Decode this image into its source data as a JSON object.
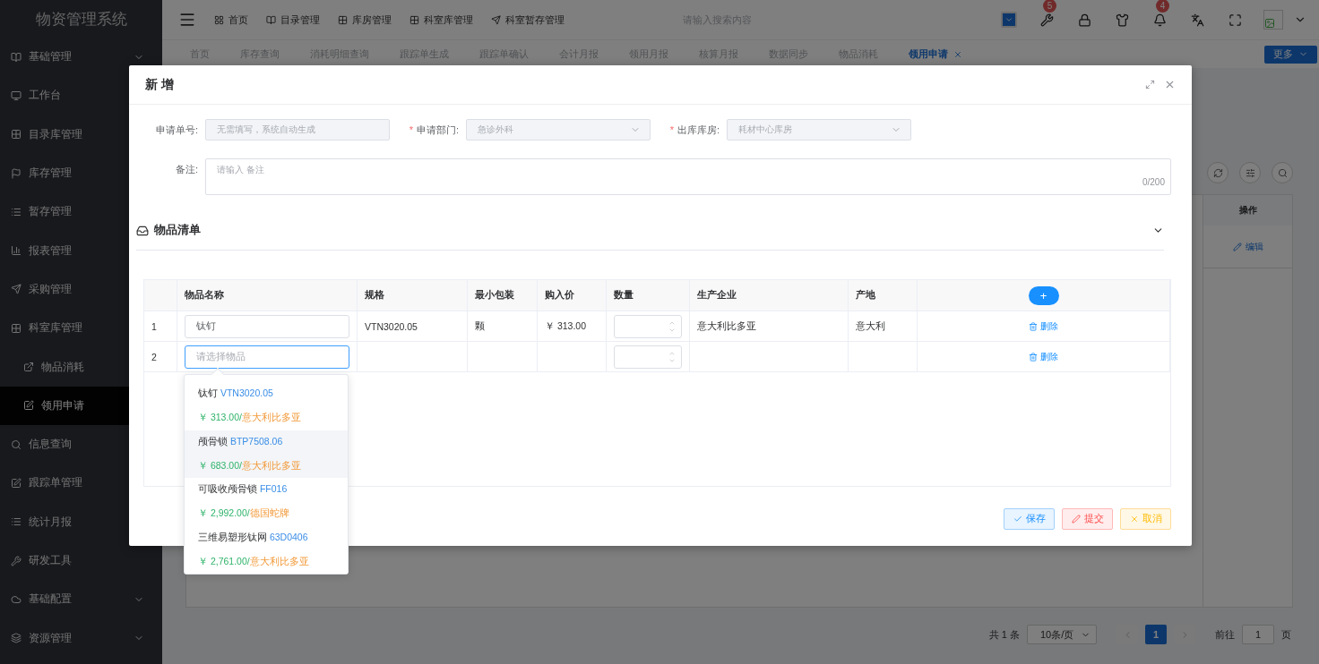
{
  "sidebar": {
    "title": "物资管理系统",
    "items": [
      {
        "label": "基础管理",
        "selected": false,
        "expanded": false
      },
      {
        "label": "工作台",
        "selected": false
      },
      {
        "label": "目录库管理",
        "selected": false
      },
      {
        "label": "库存管理",
        "selected": false
      },
      {
        "label": "暂存管理",
        "selected": false
      },
      {
        "label": "报表管理",
        "selected": false
      },
      {
        "label": "采购管理",
        "selected": false
      },
      {
        "label": "科室库管理",
        "selected": false,
        "expanded": true,
        "children": [
          {
            "label": "物品消耗",
            "selected": false
          },
          {
            "label": "领用申请",
            "selected": true
          }
        ]
      },
      {
        "label": "信息查询",
        "selected": false
      },
      {
        "label": "跟踪单管理",
        "selected": false
      },
      {
        "label": "统计月报",
        "selected": false
      },
      {
        "label": "研发工具",
        "selected": false
      },
      {
        "label": "基础配置",
        "selected": false,
        "expanded": false
      },
      {
        "label": "资源管理",
        "selected": false,
        "expanded": false
      }
    ]
  },
  "top_bar": {
    "nav": [
      {
        "label": "首页"
      },
      {
        "label": "目录管理"
      },
      {
        "label": "库房管理"
      },
      {
        "label": "科室库管理"
      },
      {
        "label": "科室暂存管理"
      }
    ],
    "search": {
      "placeholder": "请输入搜索内容"
    },
    "badges": [
      "5",
      "4"
    ]
  },
  "tabs": [
    {
      "label": "首页",
      "selected": false
    },
    {
      "label": "库存查询",
      "selected": false
    },
    {
      "label": "消耗明细查询",
      "selected": false
    },
    {
      "label": "跟踪单生成",
      "selected": false
    },
    {
      "label": "跟踪单确认",
      "selected": false
    },
    {
      "label": "会计月报",
      "selected": false
    },
    {
      "label": "领用月报",
      "selected": false
    },
    {
      "label": "核算月报",
      "selected": false
    },
    {
      "label": "数据同步",
      "selected": false
    },
    {
      "label": "物品消耗",
      "selected": false
    },
    {
      "label": "领用申请",
      "selected": true
    }
  ],
  "more_button": "更多",
  "background_table": {
    "columns": [
      "操作"
    ],
    "row_action": "编辑"
  },
  "pagination": {
    "total": "共 1 条",
    "page_size": "10条/页",
    "pages": [
      {
        "label": "1",
        "selected": true
      }
    ],
    "goto_label": "前往",
    "goto_value": "1",
    "goto_suffix": "页"
  },
  "dialog": {
    "title": "新 增",
    "fields": [
      {
        "label": "申请单号:",
        "kind": "input",
        "disabled": true,
        "placeholder": "无需填写，系统自动生成"
      },
      {
        "label": "申请部门:",
        "kind": "select",
        "required_mark": "*",
        "disabled": true,
        "value": "急诊外科"
      },
      {
        "label": "出库库房:",
        "kind": "select",
        "required_mark": "*",
        "disabled": true,
        "value": "耗材中心库房"
      }
    ],
    "remark": {
      "label": "备注:",
      "placeholder": "请输入 备注",
      "counter": "0/200"
    },
    "section_title": "物品清单",
    "table": {
      "columns": [
        "物品名称",
        "规格",
        "最小包装",
        "购入价",
        "数量",
        "生产企业",
        "产地"
      ],
      "add_button": "+",
      "rows": [
        {
          "index": "1",
          "name": {
            "value": "钛钉",
            "focused": false
          },
          "spec": "VTN3020.05",
          "pack": "颗",
          "price": "￥ 313.00",
          "maker": "意大利比多亚",
          "origin": "意大利",
          "action": "删除"
        },
        {
          "index": "2",
          "name": {
            "placeholder": "请选择物品",
            "focused": true
          },
          "spec": "",
          "pack": "",
          "price": "",
          "maker": "",
          "origin": "",
          "action": "删除"
        }
      ]
    },
    "dropdown": [
      {
        "name": "钛钉",
        "spec": "VTN3020.05",
        "price": "￥ 313.00/",
        "maker": "意大利比多亚",
        "highlighted": false
      },
      {
        "name": "颅骨锁",
        "spec": "BTP7508.06",
        "price": "￥ 683.00/",
        "maker": "意大利比多亚",
        "highlighted": true
      },
      {
        "name": "可吸收颅骨锁",
        "spec": "FF016",
        "price": "￥ 2,992.00/",
        "maker": "德国蛇牌",
        "highlighted": false
      },
      {
        "name": "三维易塑形钛网",
        "spec": "63D0406",
        "price": "￥ 2,761.00/",
        "maker": "意大利比多亚",
        "highlighted": false
      }
    ],
    "buttons": [
      {
        "label": "保存",
        "kind": "save"
      },
      {
        "label": "提交",
        "kind": "submit"
      },
      {
        "label": "取消",
        "kind": "cancel"
      }
    ]
  }
}
